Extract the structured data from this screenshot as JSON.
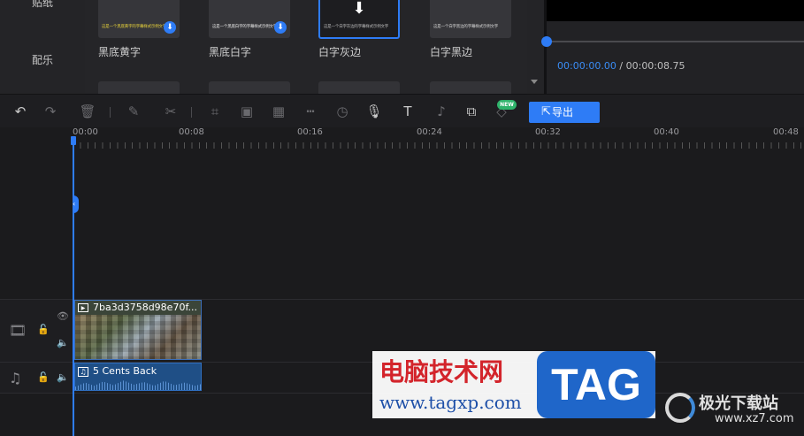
{
  "left_menu": {
    "items": [
      "贴纸",
      "配乐"
    ]
  },
  "assets": [
    {
      "name": "黑底黄字",
      "thumb_text": "这是一个黑底黄字的字幕样式示例文字",
      "thumb_color": "#e8d23a",
      "downloaded": false,
      "selected": false
    },
    {
      "name": "黑底白字",
      "thumb_text": "这是一个黑底白字的字幕样式示例文字",
      "thumb_color": "#e8e8e8",
      "downloaded": false,
      "selected": false
    },
    {
      "name": "白字灰边",
      "thumb_text": "这是一个白字灰边的字幕样式示例文字",
      "thumb_color": "#bbbbbb",
      "downloaded": false,
      "selected": true
    },
    {
      "name": "白字黑边",
      "thumb_text": "这是一个白字黑边的字幕样式示例文字",
      "thumb_color": "#d8d8d8",
      "downloaded": true,
      "selected": false
    }
  ],
  "preview": {
    "current_time": "00:00:00.00",
    "separator": " / ",
    "total_time": "00:00:08.75"
  },
  "toolbar": {
    "tools": [
      "undo-icon",
      "redo-icon",
      "delete-icon",
      "edit-icon",
      "cut-icon",
      "crop-icon",
      "speed-icon",
      "mosaic-icon",
      "freeze-icon",
      "duration-icon",
      "record-icon",
      "text-to-speech-icon",
      "voice-change-icon",
      "pip-icon",
      "tag-icon"
    ],
    "new_badge": "NEW",
    "export_label": "导出"
  },
  "ruler": {
    "labels": [
      "00:00",
      "00:08",
      "00:16",
      "00:24",
      "00:32",
      "00:40",
      "00:48"
    ]
  },
  "tracks": {
    "video_clip_title": "7ba3d3758d98e70f...",
    "audio_clip_title": "5 Cents Back"
  },
  "watermarks": {
    "tag_cn": "电脑技术网",
    "tag_url": "www.tagxp.com",
    "tag_logo": "TAG",
    "xz7_title": "极光下载站",
    "xz7_url": "www.xz7.com"
  },
  "colors": {
    "accent": "#2e7cf6",
    "new_badge": "#2fb36b"
  }
}
